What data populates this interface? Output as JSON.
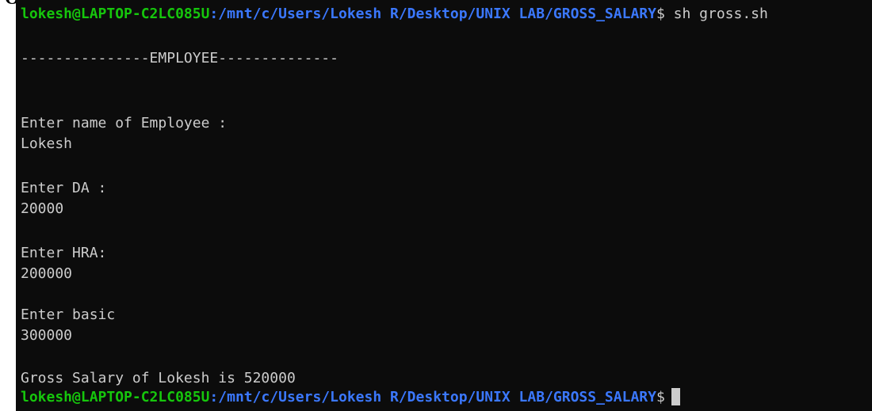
{
  "window": {
    "top_text": "Output"
  },
  "prompt": {
    "user_host": "lokesh@LAPTOP-C2LC085U",
    "separator": ":",
    "path": "/mnt/c/Users/Lokesh R/Desktop/UNIX LAB/GROSS_SALARY",
    "symbol": "$"
  },
  "command": "sh gross.sh",
  "output": {
    "banner": "---------------EMPLOYEE--------------",
    "name_prompt": "Enter name of Employee :",
    "name_value": "Lokesh",
    "da_prompt": "Enter DA :",
    "da_value": "20000",
    "hra_prompt": "Enter HRA:",
    "hra_value": "200000",
    "basic_prompt": "Enter basic",
    "basic_value": "300000",
    "result": "Gross Salary of Lokesh is 520000"
  },
  "colors": {
    "background": "#0c0c0c",
    "user_host": "#16c60c",
    "path": "#3b78ff",
    "text": "#cccccc"
  }
}
